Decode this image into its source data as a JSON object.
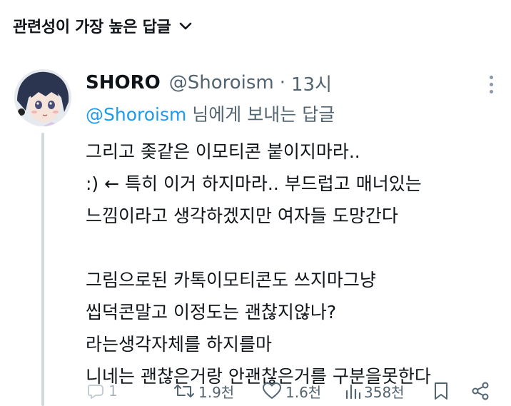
{
  "sort": {
    "label": "관련성이 가장 높은 답글"
  },
  "tweet": {
    "name": "SHORO",
    "handle": "@Shoroism",
    "separator": "·",
    "time": "13시",
    "replying_to": {
      "mention": "@Shoroism",
      "suffix": " 님에게 보내는 답글"
    },
    "lines": [
      "그리고 좆같은 이모티콘 붙이지마라..",
      ":) ← 특히 이거 하지마라.. 부드럽고 매너있는",
      "느낌이라고 생각하겠지만  여자들 도망간다",
      "",
      "그림으로된 카톡이모티콘도 쓰지마그냥",
      "씹덕콘말고 이정도는 괜찮지않나?",
      "라는생각자체를 하지를마",
      "니네는 괜찮은거랑 안괜찮은거를 구분을못한다"
    ],
    "stats": {
      "replies": "1",
      "retweets": "1.9천",
      "likes": "1.6천",
      "views": "358천"
    }
  },
  "colors": {
    "accent": "#1d9bf0",
    "muted": "#536471",
    "text": "#0f1419",
    "thread_line": "#cfd9de"
  },
  "icons": [
    "chevron-down-icon",
    "more-icon",
    "reply-icon",
    "retweet-icon",
    "like-icon",
    "views-icon",
    "bookmark-icon",
    "share-icon"
  ]
}
